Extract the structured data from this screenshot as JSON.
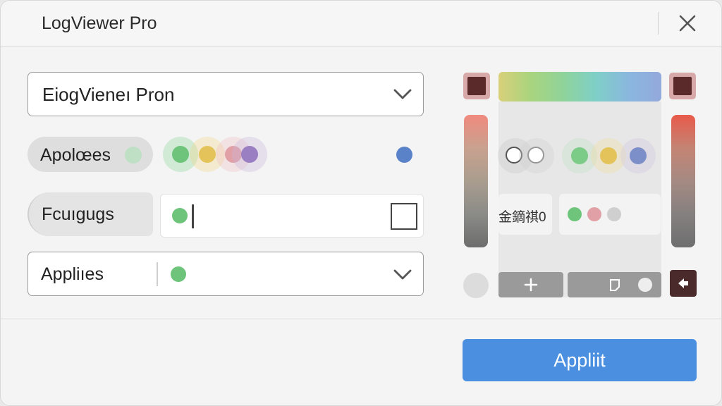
{
  "window": {
    "title": "LogViewer Pro"
  },
  "form": {
    "profile_select": {
      "value": "EiogVieneı Pron"
    },
    "category_pill": {
      "label": "Apolœes"
    },
    "filter_pill": {
      "label": "Fcuıgugs"
    },
    "input": {
      "value": ""
    },
    "applies_select": {
      "value": "Appliıes"
    }
  },
  "picker": {
    "mini_label": "金鏑祺0"
  },
  "footer": {
    "apply_label": "Appliit"
  },
  "colors": {
    "accent": "#4a8fe0",
    "green": "#6dc47a",
    "yellow": "#e4c45a",
    "pink": "#e0a0a6",
    "purple": "#9a7fc2",
    "blue": "#5a82c8",
    "red_swatch": "#5a2a2a"
  },
  "icons": {
    "close": "close-icon",
    "chevron": "chevron-down-icon",
    "plus": "plus-icon",
    "copy": "copy-icon",
    "arrow": "arrow-icon"
  }
}
